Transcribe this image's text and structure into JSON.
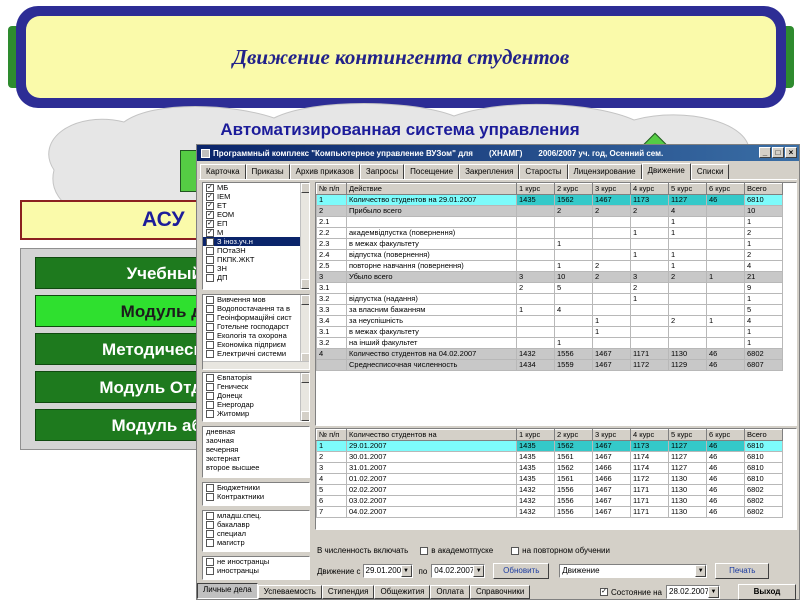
{
  "slide": {
    "title": "Движение контингента студентов",
    "subtitle": "Автоматизированная система управления",
    "asu_label": "АСУ",
    "modules": [
      "Учебный",
      "Модуль д",
      "Методическ",
      "Модуль Отд",
      "Модуль аб"
    ]
  },
  "window": {
    "title": "Программный комплекс \"Компьютерное управление ВУЗом\" для",
    "org": "(ХНАМГ)",
    "period": "2006/2007 уч. год, Осенний сем.",
    "tabs": [
      "Карточка",
      "Приказы",
      "Архив приказов",
      "Запросы",
      "Посещение",
      "Закрепления",
      "Старосты",
      "Лицензирование",
      "Движение",
      "Списки"
    ],
    "active_tab": "Движение"
  },
  "filters": {
    "faculties": [
      {
        "label": "МБ",
        "checked": true,
        "selected": false
      },
      {
        "label": "ІЕМ",
        "checked": true,
        "selected": false
      },
      {
        "label": "ЕТ",
        "checked": true,
        "selected": false
      },
      {
        "label": "ЕОМ",
        "checked": true,
        "selected": false
      },
      {
        "label": "ЕП",
        "checked": true,
        "selected": false
      },
      {
        "label": "М",
        "checked": true,
        "selected": false
      },
      {
        "label": "З іноз.уч.н",
        "checked": false,
        "selected": true
      },
      {
        "label": "ПОтаЗН",
        "checked": false,
        "selected": false
      },
      {
        "label": "ПКПК.ЖКТ",
        "checked": false,
        "selected": false
      },
      {
        "label": "ЗН",
        "checked": false,
        "selected": false
      },
      {
        "label": "ДП",
        "checked": false,
        "selected": false
      }
    ],
    "specialties": [
      "Вивчення мов",
      "Водопостачання та в",
      "Геоінформаційні сист",
      "Готельне господарст",
      "Екологія та охорона",
      "Економіка підприєм",
      "Електричні системи"
    ],
    "regions": [
      "Євпаторія",
      "Геническ",
      "Донецк",
      "Енергодар",
      "Житомир"
    ],
    "study_forms": [
      "дневная",
      "заочная",
      "вечерняя",
      "экстернат",
      "второе высшее"
    ],
    "funding": [
      "Бюджетники",
      "Контрактники"
    ],
    "levels": [
      "младш.спец.",
      "бакалавр",
      "специал",
      "магистр"
    ],
    "citizenship": [
      "не иностранцы",
      "иностранцы"
    ]
  },
  "movement_table": {
    "headers": [
      "№ п/п",
      "Действие",
      "1 курс",
      "2 курс",
      "3 курс",
      "4 курс",
      "5 курс",
      "6 курс",
      "Всего"
    ],
    "rows": [
      {
        "style": "hl",
        "cells": [
          "1",
          "Количество студентов на 29.01.2007",
          "1435",
          "1562",
          "1467",
          "1173",
          "1127",
          "46",
          "6810"
        ]
      },
      {
        "style": "gray",
        "cells": [
          "2",
          "Прибыло всего",
          "",
          "2",
          "2",
          "2",
          "4",
          "",
          "10"
        ]
      },
      {
        "style": "",
        "cells": [
          "2.1",
          "",
          "",
          "",
          "",
          "",
          "1",
          "",
          "1"
        ]
      },
      {
        "style": "",
        "cells": [
          "2.2",
          "академвідпустка (повернення)",
          "",
          "",
          "",
          "1",
          "1",
          "",
          "2"
        ]
      },
      {
        "style": "",
        "cells": [
          "2.3",
          "в межах факультету",
          "",
          "1",
          "",
          "",
          "",
          "",
          "1"
        ]
      },
      {
        "style": "",
        "cells": [
          "2.4",
          "відпустка (повернення)",
          "",
          "",
          "",
          "1",
          "1",
          "",
          "2"
        ]
      },
      {
        "style": "",
        "cells": [
          "2.5",
          "повторне навчання (повернення)",
          "",
          "1",
          "2",
          "",
          "1",
          "",
          "4"
        ]
      },
      {
        "style": "gray",
        "cells": [
          "3",
          "Убыло всего",
          "3",
          "10",
          "2",
          "3",
          "2",
          "1",
          "21"
        ]
      },
      {
        "style": "",
        "cells": [
          "3.1",
          "",
          "2",
          "5",
          "",
          "2",
          "",
          "",
          "9"
        ]
      },
      {
        "style": "",
        "cells": [
          "3.2",
          "відпустка (надання)",
          "",
          "",
          "",
          "1",
          "",
          "",
          "1"
        ]
      },
      {
        "style": "",
        "cells": [
          "3.3",
          "за власним бажанням",
          "1",
          "4",
          "",
          "",
          "",
          "",
          "5"
        ]
      },
      {
        "style": "",
        "cells": [
          "3.4",
          "за неуспішність",
          "",
          "",
          "1",
          "",
          "2",
          "1",
          "4"
        ]
      },
      {
        "style": "",
        "cells": [
          "3.1",
          "в межах факультету",
          "",
          "",
          "1",
          "",
          "",
          "",
          "1"
        ]
      },
      {
        "style": "",
        "cells": [
          "3.2",
          "на інший факультет",
          "",
          "1",
          "",
          "",
          "",
          "",
          "1"
        ]
      },
      {
        "style": "gray",
        "cells": [
          "4",
          "Количество студентов на 04.02.2007",
          "1432",
          "1556",
          "1467",
          "1171",
          "1130",
          "46",
          "6802"
        ]
      },
      {
        "style": "gray",
        "cells": [
          "",
          "Среднесписочная численность",
          "1434",
          "1559",
          "1467",
          "1172",
          "1129",
          "46",
          "6807"
        ]
      }
    ]
  },
  "count_table": {
    "headers": [
      "№ п/п",
      "Количество студентов на",
      "1 курс",
      "2 курс",
      "3 курс",
      "4 курс",
      "5 курс",
      "6 курс",
      "Всего"
    ],
    "rows": [
      {
        "style": "hl",
        "cells": [
          "1",
          "29.01.2007",
          "1435",
          "1562",
          "1467",
          "1173",
          "1127",
          "46",
          "6810"
        ]
      },
      {
        "style": "",
        "cells": [
          "2",
          "30.01.2007",
          "1435",
          "1561",
          "1467",
          "1174",
          "1127",
          "46",
          "6810"
        ]
      },
      {
        "style": "",
        "cells": [
          "3",
          "31.01.2007",
          "1435",
          "1562",
          "1466",
          "1174",
          "1127",
          "46",
          "6810"
        ]
      },
      {
        "style": "",
        "cells": [
          "4",
          "01.02.2007",
          "1435",
          "1561",
          "1466",
          "1172",
          "1130",
          "46",
          "6810"
        ]
      },
      {
        "style": "",
        "cells": [
          "5",
          "02.02.2007",
          "1432",
          "1556",
          "1467",
          "1171",
          "1130",
          "46",
          "6802"
        ]
      },
      {
        "style": "",
        "cells": [
          "6",
          "03.02.2007",
          "1432",
          "1556",
          "1467",
          "1171",
          "1130",
          "46",
          "6802"
        ]
      },
      {
        "style": "",
        "cells": [
          "7",
          "04.02.2007",
          "1432",
          "1556",
          "1467",
          "1171",
          "1130",
          "46",
          "6802"
        ]
      }
    ]
  },
  "options": {
    "include_label": "В численность включать",
    "academic_leave": "в академотпуске",
    "repeat_study": "на повторном обучении"
  },
  "controls": {
    "from_label": "Движение с",
    "from_date": "29.01.2007",
    "to_label": "по",
    "to_date": "04.02.2007",
    "refresh_button": "Обновить",
    "report_select": "Движение",
    "print_button": "Печать",
    "state_label": "Состояние на",
    "state_date": "28.02.2007",
    "exit_button": "Выход"
  },
  "bottom_tabs": [
    "Личные дела",
    "Успеваемость",
    "Стипендия",
    "Общежития",
    "Оплата",
    "Справочники"
  ],
  "active_bottom_tab": "Личные дела"
}
